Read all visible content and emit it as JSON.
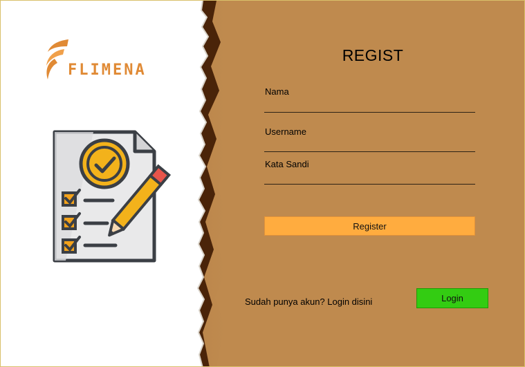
{
  "brand": {
    "name": "FLIMENA",
    "color": "#e08a35"
  },
  "illustration": {
    "icon": "checklist-document-with-pencil-icon"
  },
  "form": {
    "title": "REGIST",
    "nama_label": "Nama",
    "nama_value": "",
    "username_label": "Username",
    "username_value": "",
    "password_label": "Kata Sandi",
    "password_value": "",
    "register_button": "Register"
  },
  "footer": {
    "prompt": "Sudah punya akun? Login disini",
    "login_button": "Login"
  },
  "colors": {
    "background": "#bf8a4e",
    "register_button": "#ffac3f",
    "login_button": "#33cc12"
  }
}
